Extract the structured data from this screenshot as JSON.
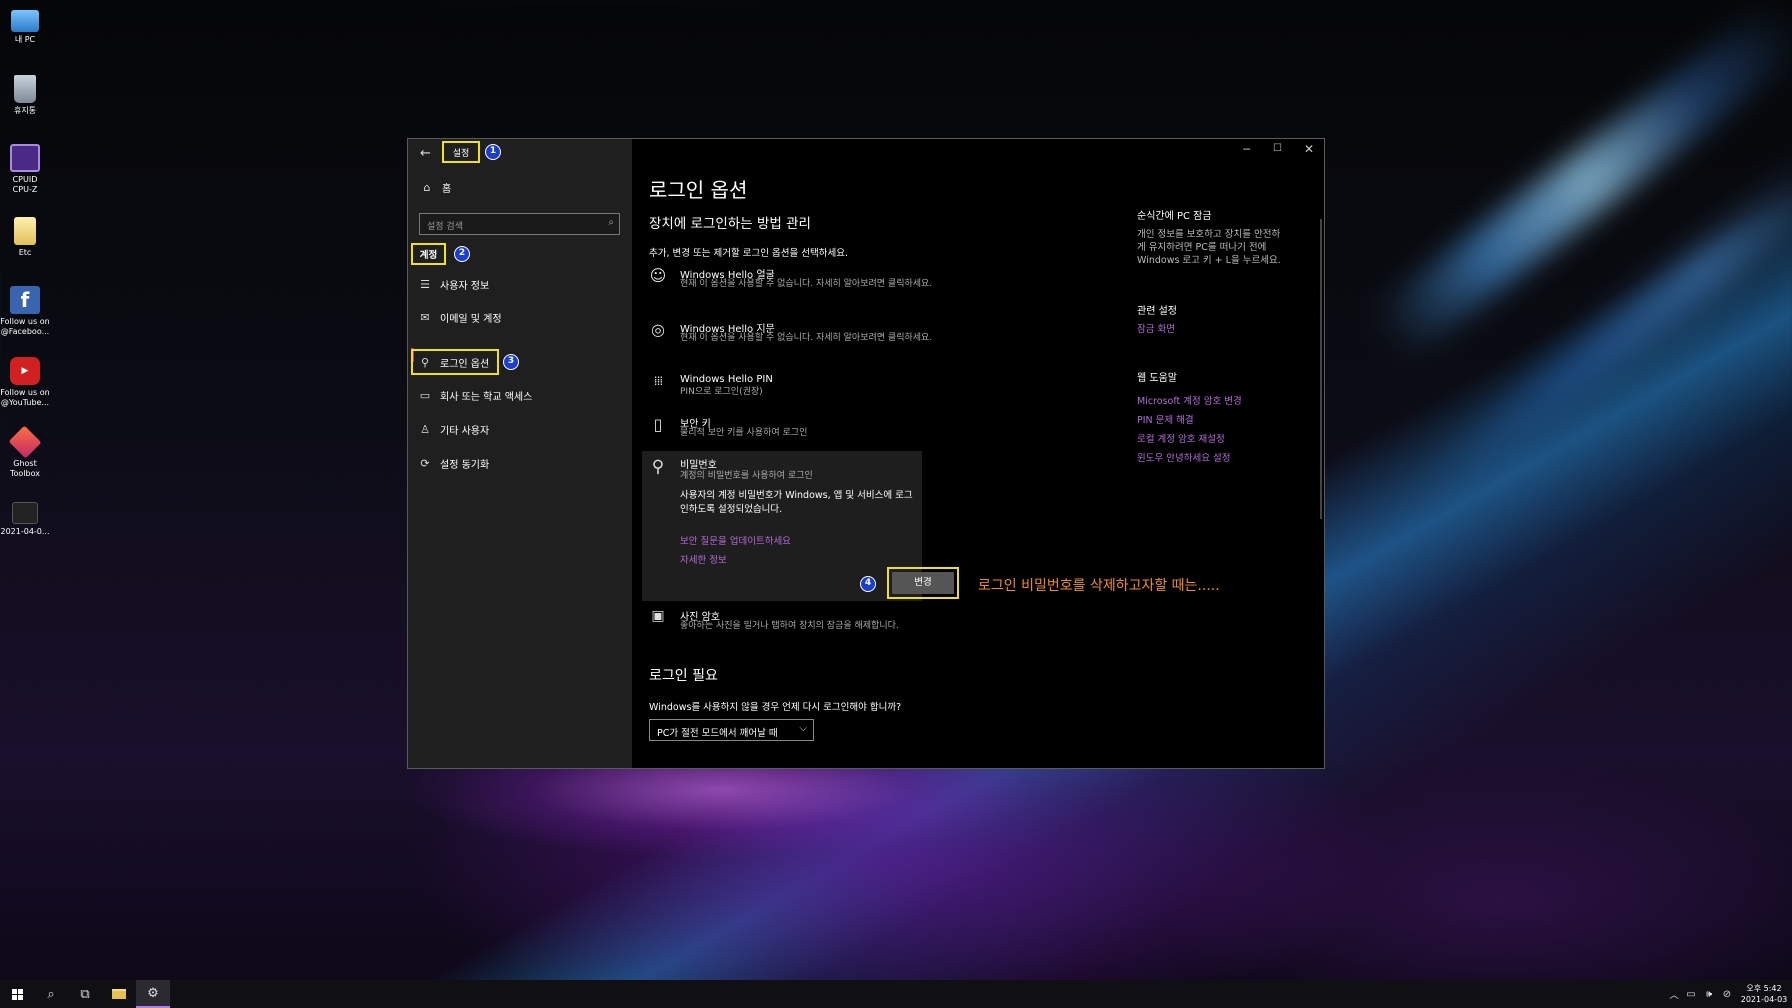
{
  "desktop_icons": [
    {
      "label": "내 PC",
      "icon": "computer-icon",
      "color": "#4aa3e8"
    },
    {
      "label": "휴지통",
      "icon": "recycle-bin-icon",
      "color": "#8fa0b0"
    },
    {
      "label": "CPUID CPU-Z",
      "icon": "cpuz-icon",
      "color": "#6a3fa8"
    },
    {
      "label": "Etc",
      "icon": "folder-icon",
      "color": "#e8c860"
    },
    {
      "label": "Follow us on @Faceboo...",
      "icon": "facebook-icon",
      "color": "#3a63b0"
    },
    {
      "label": "Follow us on @YouTube...",
      "icon": "youtube-icon",
      "color": "#d02020"
    },
    {
      "label": "Ghost Toolbox",
      "icon": "ghost-toolbox-icon",
      "color": "#e0582a"
    },
    {
      "label": "2021-04-0...",
      "icon": "file-icon",
      "color": "#222222"
    }
  ],
  "window": {
    "title": "설정",
    "home": "홈",
    "search_placeholder": "설정 검색",
    "category": "계정",
    "nav": [
      {
        "label": "사용자 정보",
        "icon": "user-info-icon"
      },
      {
        "label": "이메일 및 계정",
        "icon": "email-icon"
      },
      {
        "label": "로그인 옵션",
        "icon": "key-icon"
      },
      {
        "label": "회사 또는 학교 액세스",
        "icon": "briefcase-icon"
      },
      {
        "label": "기타 사용자",
        "icon": "person-icon"
      },
      {
        "label": "설정 동기화",
        "icon": "sync-icon"
      }
    ],
    "markers": [
      "1",
      "2",
      "3",
      "4"
    ]
  },
  "main": {
    "title": "로그인 옵션",
    "subtitle": "장치에 로그인하는 방법 관리",
    "instruction": "추가, 변경 또는 제거할 로그인 옵션을 선택하세요.",
    "options": [
      {
        "title": "Windows Hello 얼굴",
        "desc": "현재 이 옵션을 사용할 수 없습니다. 자세히 알아보려면 클릭하세요.",
        "icon": "face-icon"
      },
      {
        "title": "Windows Hello 지문",
        "desc": "현재 이 옵션을 사용할 수 없습니다. 자세히 알아보려면 클릭하세요.",
        "icon": "fingerprint-icon"
      },
      {
        "title": "Windows Hello PIN",
        "desc": "PIN으로 로그인(권장)",
        "icon": "pin-keypad-icon"
      },
      {
        "title": "보안 키",
        "desc": "물리적 보안 키를 사용하여 로그인",
        "icon": "usb-key-icon"
      }
    ],
    "password": {
      "title": "비밀번호",
      "desc": "계정의 비밀번호를 사용하여 로그인",
      "info": "사용자의 계정 비밀번호가 Windows, 앱 및 서비스에 로그인하도록 설정되었습니다.",
      "link1": "보안 질문을 업데이트하세요",
      "link2": "자세한 정보",
      "button": "변경"
    },
    "picture": {
      "title": "사진 암호",
      "desc": "좋아하는 사진을 밀거나 탭하여 장치의 잠금을 해제합니다."
    },
    "annotation": "로그인 비밀번호를 삭제하고자할 때는.....",
    "require_title": "로그인 필요",
    "require_question": "Windows를 사용하지 않을 경우 언제 다시 로그인해야 합니까?",
    "require_value": "PC가 절전 모드에서 깨어날 때"
  },
  "right": {
    "lock_title": "순식간에 PC 잠금",
    "lock_text": "개인 정보를 보호하고 장치를 안전하게 유지하려면 PC를 떠나기 전에 Windows 로고 키 + L을 누르세요.",
    "related_title": "관련 설정",
    "related_link": "잠금 화면",
    "help_title": "웹 도움말",
    "help_links": [
      "Microsoft 계정 암호 변경",
      "PIN 문제 해결",
      "로컬 계정 암호 재설정",
      "윈도우 안녕하세요 설정"
    ]
  },
  "taskbar": {
    "time": "오후 5:42",
    "date": "2021-04-03"
  }
}
